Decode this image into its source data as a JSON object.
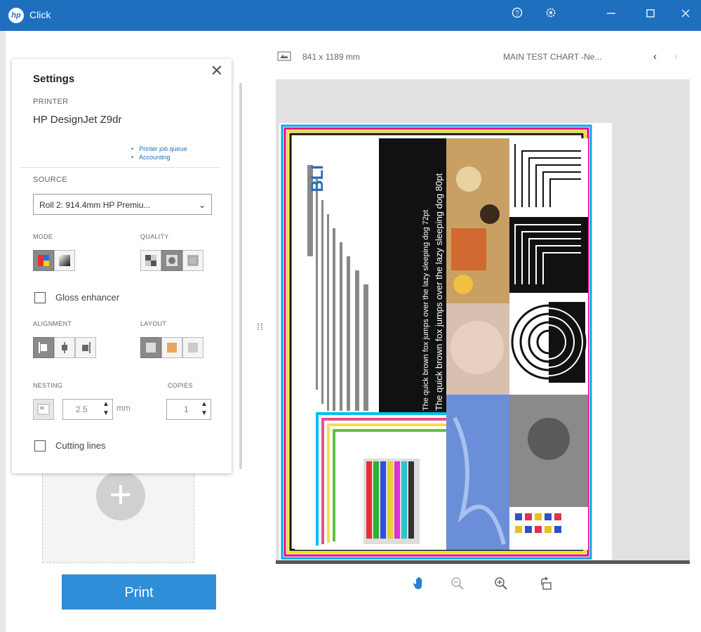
{
  "window": {
    "app_title": "Click",
    "logo_text": "hp",
    "controls": [
      "help-icon",
      "settings-icon",
      "minimize-icon",
      "maximize-icon",
      "close-icon"
    ]
  },
  "settings": {
    "title": "Settings",
    "printer_label": "PRINTER",
    "printer_name": "HP DesignJet Z9dr",
    "links": [
      "Printer job queue",
      "Accounting"
    ],
    "source_label": "SOURCE",
    "source_value": "Roll 2: 914.4mm HP Premiu...",
    "mode_label": "MODE",
    "quality_label": "QUALITY",
    "gloss_label": "Gloss enhancer",
    "gloss_checked": false,
    "alignment_label": "ALIGNMENT",
    "layout_label": "LAYOUT",
    "nesting_label": "NESTING",
    "nesting_value": "2.5",
    "nesting_unit": "mm",
    "copies_label": "COPIES",
    "copies_value": "1",
    "cutting_label": "Cutting lines",
    "cutting_checked": false
  },
  "print_button": "Print",
  "preview": {
    "dimensions": "841 x 1189 mm",
    "document_title": "MAIN TEST CHART -Ne...",
    "nav_prev": "‹",
    "nav_next": "›",
    "chart_text_top": "The quick brown fox jumps over the lazy sleeping dog 80pt",
    "chart_text_2": "The quick brown fox jumps over the lazy sleeping dog 72pt",
    "chart_logo": "BLI"
  },
  "zoom_tools": [
    "pan-hand-icon",
    "zoom-out-icon",
    "zoom-in-icon",
    "rotate-icon"
  ]
}
